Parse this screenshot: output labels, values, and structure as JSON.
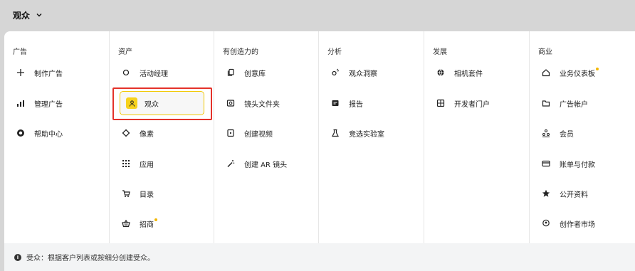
{
  "header": {
    "title": "观众"
  },
  "columns": [
    {
      "header": "广告",
      "items": [
        {
          "label": "制作广告",
          "icon": "plus-icon"
        },
        {
          "label": "管理广告",
          "icon": "bar-chart-icon"
        },
        {
          "label": "帮助中心",
          "icon": "lifebuoy-icon"
        }
      ]
    },
    {
      "header": "资产",
      "items": [
        {
          "label": "活动经理",
          "icon": "circle-icon"
        },
        {
          "label": "观众",
          "icon": "audience-icon",
          "selected": true
        },
        {
          "label": "像素",
          "icon": "diamond-icon"
        },
        {
          "label": "应用",
          "icon": "grid-icon"
        },
        {
          "label": "目录",
          "icon": "cart-icon"
        },
        {
          "label": "招商",
          "icon": "basket-icon",
          "dot": true
        }
      ]
    },
    {
      "header": "有创造力的",
      "items": [
        {
          "label": "创意库",
          "icon": "copy-icon"
        },
        {
          "label": "镜头文件夹",
          "icon": "lens-folder-icon"
        },
        {
          "label": "创建视频",
          "icon": "video-icon"
        },
        {
          "label": "创建 AR 镜头",
          "icon": "magic-wand-icon"
        }
      ]
    },
    {
      "header": "分析",
      "items": [
        {
          "label": "观众洞察",
          "icon": "insights-icon"
        },
        {
          "label": "报告",
          "icon": "report-icon"
        },
        {
          "label": "竞选实验室",
          "icon": "flask-icon"
        }
      ]
    },
    {
      "header": "发展",
      "items": [
        {
          "label": "相机套件",
          "icon": "globe-icon"
        },
        {
          "label": "开发者门户",
          "icon": "portal-icon"
        }
      ]
    },
    {
      "header": "商业",
      "items": [
        {
          "label": "业务仪表板",
          "icon": "home-icon",
          "dot": true
        },
        {
          "label": "广告帐户",
          "icon": "folder-icon"
        },
        {
          "label": "会员",
          "icon": "members-icon"
        },
        {
          "label": "账单与付款",
          "icon": "card-icon"
        },
        {
          "label": "公开资料",
          "icon": "star-icon"
        },
        {
          "label": "创作者市场",
          "icon": "pin-icon"
        }
      ]
    }
  ],
  "footer": {
    "text": "受众：根据客户列表或按细分创建受众。"
  },
  "colors": {
    "accent": "#f7d21c",
    "highlight_border": "#e4322a",
    "dot": "#f2b705"
  }
}
